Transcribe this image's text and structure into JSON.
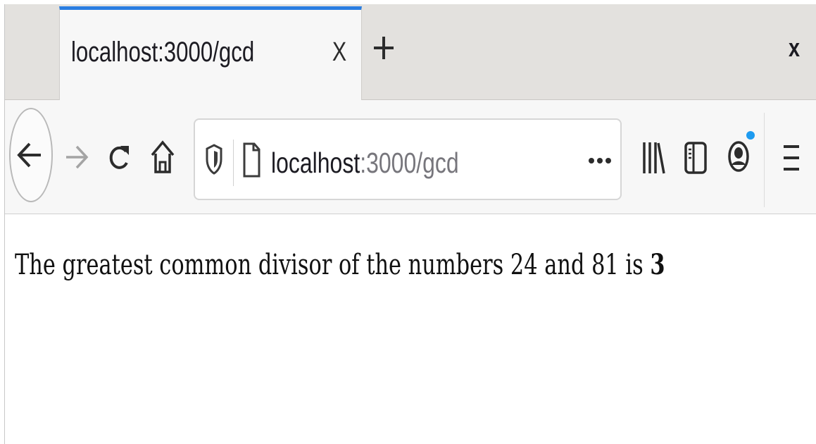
{
  "browser": {
    "tab": {
      "title": "localhost:3000/gcd",
      "close_label": "X"
    },
    "window_close_label": "x",
    "url": {
      "host": "localhost",
      "rest": ":3000/gcd"
    },
    "accent_color": "#2a7de1",
    "notification_dot_color": "#1e9bf0",
    "icons": [
      "back-arrow-icon",
      "forward-arrow-icon",
      "reload-icon",
      "home-icon",
      "tracking-shield-icon",
      "page-icon",
      "more-options-icon",
      "library-icon",
      "sidebar-icon",
      "account-icon",
      "menu-icon",
      "new-tab-plus-icon"
    ]
  },
  "page": {
    "message_prefix": "The greatest common divisor of the numbers 24 and 81 is ",
    "result": "3"
  }
}
